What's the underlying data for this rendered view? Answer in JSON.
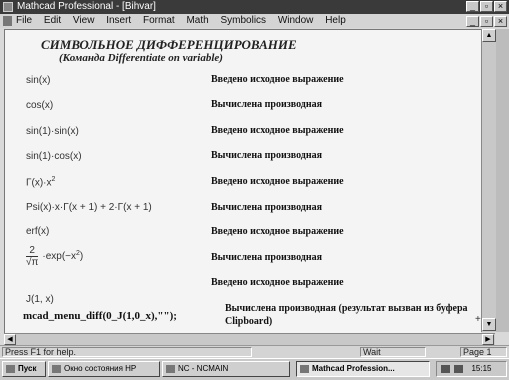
{
  "window": {
    "title": "Mathcad Professional - [Bihvar]",
    "min_glyph": "_",
    "max_glyph": "▫",
    "close_glyph": "×"
  },
  "menu": [
    "File",
    "Edit",
    "View",
    "Insert",
    "Format",
    "Math",
    "Symbolics",
    "Window",
    "Help"
  ],
  "document": {
    "heading": "СИМВОЛЬНОЕ ДИФФЕРЕНЦИРОВАНИЕ",
    "subheading": "(Команда Differentiate on variable)",
    "rows": [
      {
        "expr": "sin(x)",
        "note": "Введено исходное выражение"
      },
      {
        "expr": "cos(x)",
        "note": "Вычислена производная"
      },
      {
        "expr": "sin(1)·sin(x)",
        "note": "Введено исходное выражение"
      },
      {
        "expr": "sin(1)·cos(x)",
        "note": "Вычислена производная"
      },
      {
        "expr": "Γ(x)·x",
        "expr_sup": "2",
        "note": "Введено исходное выражение"
      },
      {
        "expr": "Psi(x)·x·Γ(x + 1) + 2·Γ(x + 1)",
        "note": "Вычислена производная"
      },
      {
        "expr": "erf(x)",
        "note": "Введено исходное выражение"
      },
      {
        "expr_num": "2",
        "expr_den": "√π",
        "expr_tail": "·exp(−x",
        "expr_sup": "2",
        "expr_end": ")",
        "note": "Вычислена производная"
      },
      {
        "expr": "",
        "note": "Введено исходное выражение"
      },
      {
        "expr": "J(1, x)",
        "note": ""
      }
    ],
    "command": "mcad_menu_diff(0_J(1,0_x),\"\");",
    "last_note": "Вычислена производная (результат вызван из буфера Clipboard)",
    "plus_mark": "+"
  },
  "status": {
    "hint": "Press F1 for help.",
    "mode": "Wait",
    "page": "Page 1"
  },
  "taskbar": {
    "start": "Пуск",
    "items": [
      {
        "label": "Окно состояния HP"
      },
      {
        "label": "NC - NCMAIN"
      },
      {
        "label": "Mathcad Profession..."
      }
    ],
    "clock": "15:15"
  },
  "colors": {
    "titlebar": "#3a3a3a",
    "document_bg": "#f4f4f4"
  }
}
